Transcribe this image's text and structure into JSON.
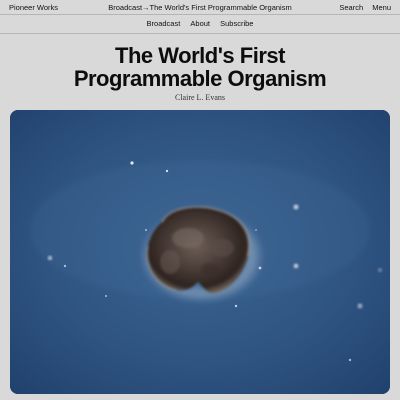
{
  "header": {
    "brand": "Pioneer Works",
    "breadcrumb": {
      "section": "Broadcast",
      "separator": "→",
      "current": "The World's First Programmable Organism"
    },
    "actions": [
      "Search",
      "Menu"
    ]
  },
  "subnav": {
    "items": [
      "Broadcast",
      "About",
      "Subscribe"
    ]
  },
  "article": {
    "title_lines": [
      "The World's First",
      "Programmable Organism"
    ],
    "author": "Claire L. Evans"
  },
  "colors": {
    "page_background": "#d9d9d9",
    "hero_background": "#2e527f",
    "text": "#111111"
  }
}
